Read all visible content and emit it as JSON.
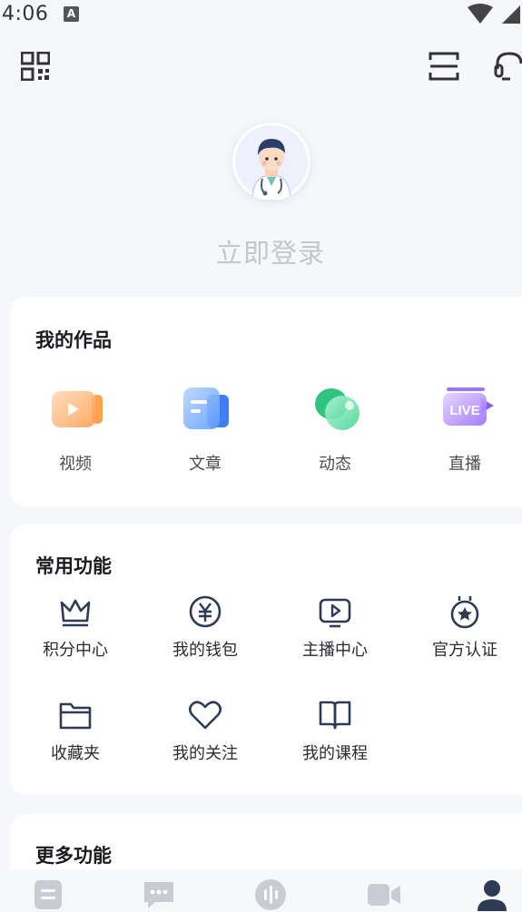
{
  "status_bar": {
    "time": "4:06",
    "notification_badge": "A"
  },
  "profile": {
    "login_label": "立即登录"
  },
  "works": {
    "title": "我的作品",
    "items": [
      {
        "label": "视频",
        "icon": "video-icon"
      },
      {
        "label": "文章",
        "icon": "article-icon"
      },
      {
        "label": "动态",
        "icon": "moments-icon"
      },
      {
        "label": "直播",
        "icon": "live-icon",
        "badge": "LIVE"
      }
    ]
  },
  "common_functions": {
    "title": "常用功能",
    "items": [
      {
        "label": "积分中心",
        "icon": "crown-icon"
      },
      {
        "label": "我的钱包",
        "icon": "yuan-coin-icon"
      },
      {
        "label": "主播中心",
        "icon": "play-screen-icon"
      },
      {
        "label": "官方认证",
        "icon": "medal-icon"
      },
      {
        "label": "收藏夹",
        "icon": "folder-icon"
      },
      {
        "label": "我的关注",
        "icon": "heart-icon"
      },
      {
        "label": "我的课程",
        "icon": "book-icon"
      }
    ]
  },
  "more_functions": {
    "title": "更多功能"
  },
  "bottom_nav": {
    "tabs": [
      {
        "icon": "home-doc-icon"
      },
      {
        "icon": "chat-icon"
      },
      {
        "icon": "audio-icon"
      },
      {
        "icon": "video-camera-icon"
      },
      {
        "icon": "profile-icon",
        "active": true
      }
    ]
  },
  "colors": {
    "accent": "#2f3a55",
    "background": "#f6f7fa",
    "card": "#ffffff"
  }
}
